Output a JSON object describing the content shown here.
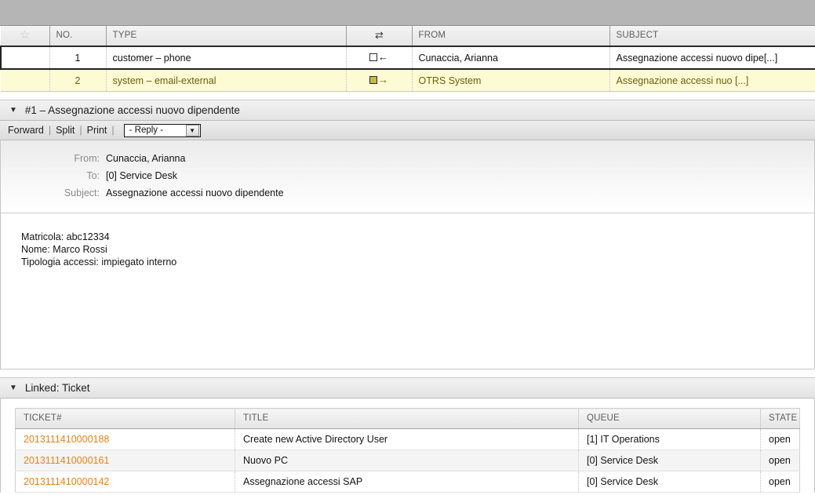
{
  "article_list": {
    "columns": [
      {
        "key": "star",
        "label": "",
        "icon": "star-icon"
      },
      {
        "key": "no",
        "label": "NO."
      },
      {
        "key": "type",
        "label": "TYPE"
      },
      {
        "key": "dir",
        "label": "",
        "icon": "swap-arrows-icon"
      },
      {
        "key": "from",
        "label": "FROM"
      },
      {
        "key": "subject",
        "label": "SUBJECT"
      }
    ],
    "rows": [
      {
        "no": "1",
        "type": "customer – phone",
        "direction_icon": "incoming-arrow-icon",
        "from": "Cunaccia, Arianna",
        "subject": "Assegnazione accessi nuovo dipe[...]",
        "state": "active"
      },
      {
        "no": "2",
        "type": "system – email-external",
        "direction_icon": "outgoing-arrow-icon",
        "from": "OTRS System",
        "subject": "Assegnazione accessi nuo [...]",
        "state": "seen"
      }
    ]
  },
  "article": {
    "header_title": "#1 – Assegnazione accessi nuovo dipendente",
    "collapse_icon": "triangle-down-icon",
    "toolbar": {
      "forward_label": "Forward",
      "split_label": "Split",
      "print_label": "Print",
      "separator": "|",
      "reply_select_value": "- Reply -",
      "reply_select_arrow": "chevron-down-icon"
    },
    "meta": [
      {
        "label": "From:",
        "value": "Cunaccia, Arianna"
      },
      {
        "label": "To:",
        "value": "[0] Service Desk"
      },
      {
        "label": "Subject:",
        "value": "Assegnazione accessi nuovo dipendente"
      }
    ],
    "body_lines": [
      "Matricola: abc12334",
      "Nome: Marco Rossi",
      "Tipologia accessi: impiegato interno"
    ]
  },
  "linked": {
    "header_title": "Linked: Ticket",
    "collapse_icon": "triangle-down-icon",
    "columns": [
      {
        "key": "ticket",
        "label": "TICKET#"
      },
      {
        "key": "title",
        "label": "TITLE"
      },
      {
        "key": "queue",
        "label": "QUEUE"
      },
      {
        "key": "state",
        "label": "STATE"
      }
    ],
    "rows": [
      {
        "ticket": "2013111410000188",
        "title": "Create new Active Directory User",
        "queue": "[1] IT Operations",
        "state": "open"
      },
      {
        "ticket": "2013111410000161",
        "title": "Nuovo PC",
        "queue": "[0] Service Desk",
        "state": "open"
      },
      {
        "ticket": "2013111410000142",
        "title": "Assegnazione accessi SAP",
        "queue": "[0] Service Desk",
        "state": "open"
      }
    ]
  },
  "colors": {
    "link_orange": "#e8821a",
    "row_seen_bg": "#fdfbd4",
    "row_seen_text": "#6e5d09",
    "top_strip": "#b5b5b5"
  }
}
